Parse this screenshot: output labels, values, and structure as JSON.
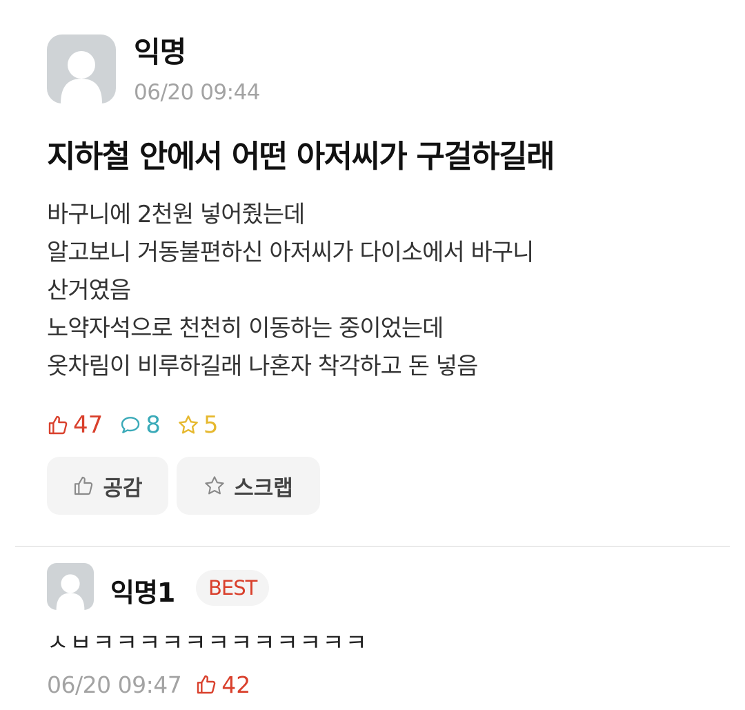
{
  "post": {
    "author": "익명",
    "time": "06/20 09:44",
    "title": "지하철 안에서 어떤 아저씨가 구걸하길래",
    "body_lines": [
      "바구니에 2천원 넣어줬는데",
      "알고보니 거동불편하신 아저씨가 다이소에서 바구니",
      "산거였음",
      "노약자석으로 천천히 이동하는 중이었는데",
      "옷차림이 비루하길래 나혼자 착각하고 돈 넣음"
    ],
    "stats": {
      "likes": "47",
      "comments": "8",
      "scraps": "5"
    },
    "buttons": {
      "like_label": "공감",
      "scrap_label": "스크랩"
    }
  },
  "comment": {
    "author": "익명1",
    "badge": "BEST",
    "text": "ㅅㅂㅋㅋㅋㅋㅋㅋㅋㅋㅋㅋㅋㅋ",
    "time": "06/20 09:47",
    "likes": "42"
  },
  "icons": {
    "avatar": "default-user-avatar",
    "like": "thumbs-up-icon",
    "comment": "speech-bubble-icon",
    "scrap": "star-icon"
  },
  "colors": {
    "like": "#d9402c",
    "comment": "#3aaab8",
    "scrap": "#e6b82e",
    "time": "#a3a3a3",
    "avatar_bg": "#cfd3d6",
    "button_bg": "#f4f4f4"
  }
}
